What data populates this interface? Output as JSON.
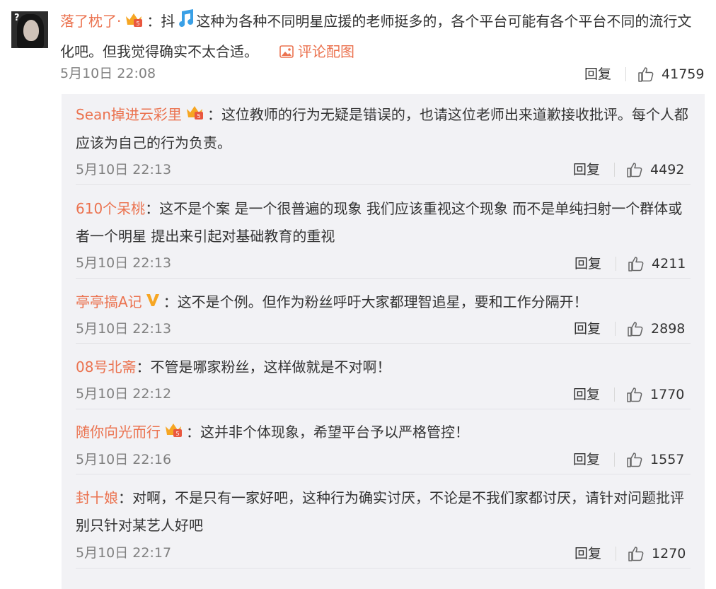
{
  "main": {
    "username": "落了枕了·",
    "colon": "：",
    "text_prefix": "抖",
    "text": "这种为各种不同明星应援的老师挺多的，各个平台可能有各个平台不同的流行文化吧。但我觉得确实不太合适。",
    "pic_link": "评论配图",
    "time": "5月10日 22:08",
    "reply_label": "回复",
    "likes": "41759"
  },
  "replies": [
    {
      "username": "Sean掉进云彩里",
      "badge": "vip",
      "text": "这位教师的行为无疑是错误的，也请这位老师出来道歉接收批评。每个人都应该为自己的行为负责。",
      "time": "5月10日 22:13",
      "reply_label": "回复",
      "likes": "4492"
    },
    {
      "username": "610个呆桃",
      "badge": "",
      "text": "这不是个案 是一个很普遍的现象 我们应该重视这个现象 而不是单纯扫射一个群体或者一个明星 提出来引起对基础教育的重视",
      "time": "5月10日 22:13",
      "reply_label": "回复",
      "likes": "4211"
    },
    {
      "username": "亭亭搞A记",
      "badge": "v",
      "text": "这不是个例。但作为粉丝呼吁大家都理智追星，要和工作分隔开！",
      "time": "5月10日 22:13",
      "reply_label": "回复",
      "likes": "2898"
    },
    {
      "username": "08号北斋",
      "badge": "",
      "text": "不管是哪家粉丝，这样做就是不对啊！",
      "time": "5月10日 22:12",
      "reply_label": "回复",
      "likes": "1770"
    },
    {
      "username": "随你向光而行",
      "badge": "vip",
      "text": "这并非个体现象，希望平台予以严格管控！",
      "time": "5月10日 22:16",
      "reply_label": "回复",
      "likes": "1557"
    },
    {
      "username": "封十娘",
      "badge": "",
      "text": "对啊，不是只有一家好吧，这种行为确实讨厌，不论是不我们家都讨厌，请针对问题批评别只针对某艺人好吧",
      "time": "5月10日 22:17",
      "reply_label": "回复",
      "likes": "1270"
    }
  ],
  "colors": {
    "username": "#eb7350",
    "time": "#808080",
    "reply_bg": "#f2f2f5"
  },
  "icons": {
    "vip": "crown-vip-icon",
    "v": "gold-v-icon",
    "like": "thumbs-up-icon",
    "picture": "image-icon",
    "tiktok": "tiktok-music-note-icon"
  }
}
